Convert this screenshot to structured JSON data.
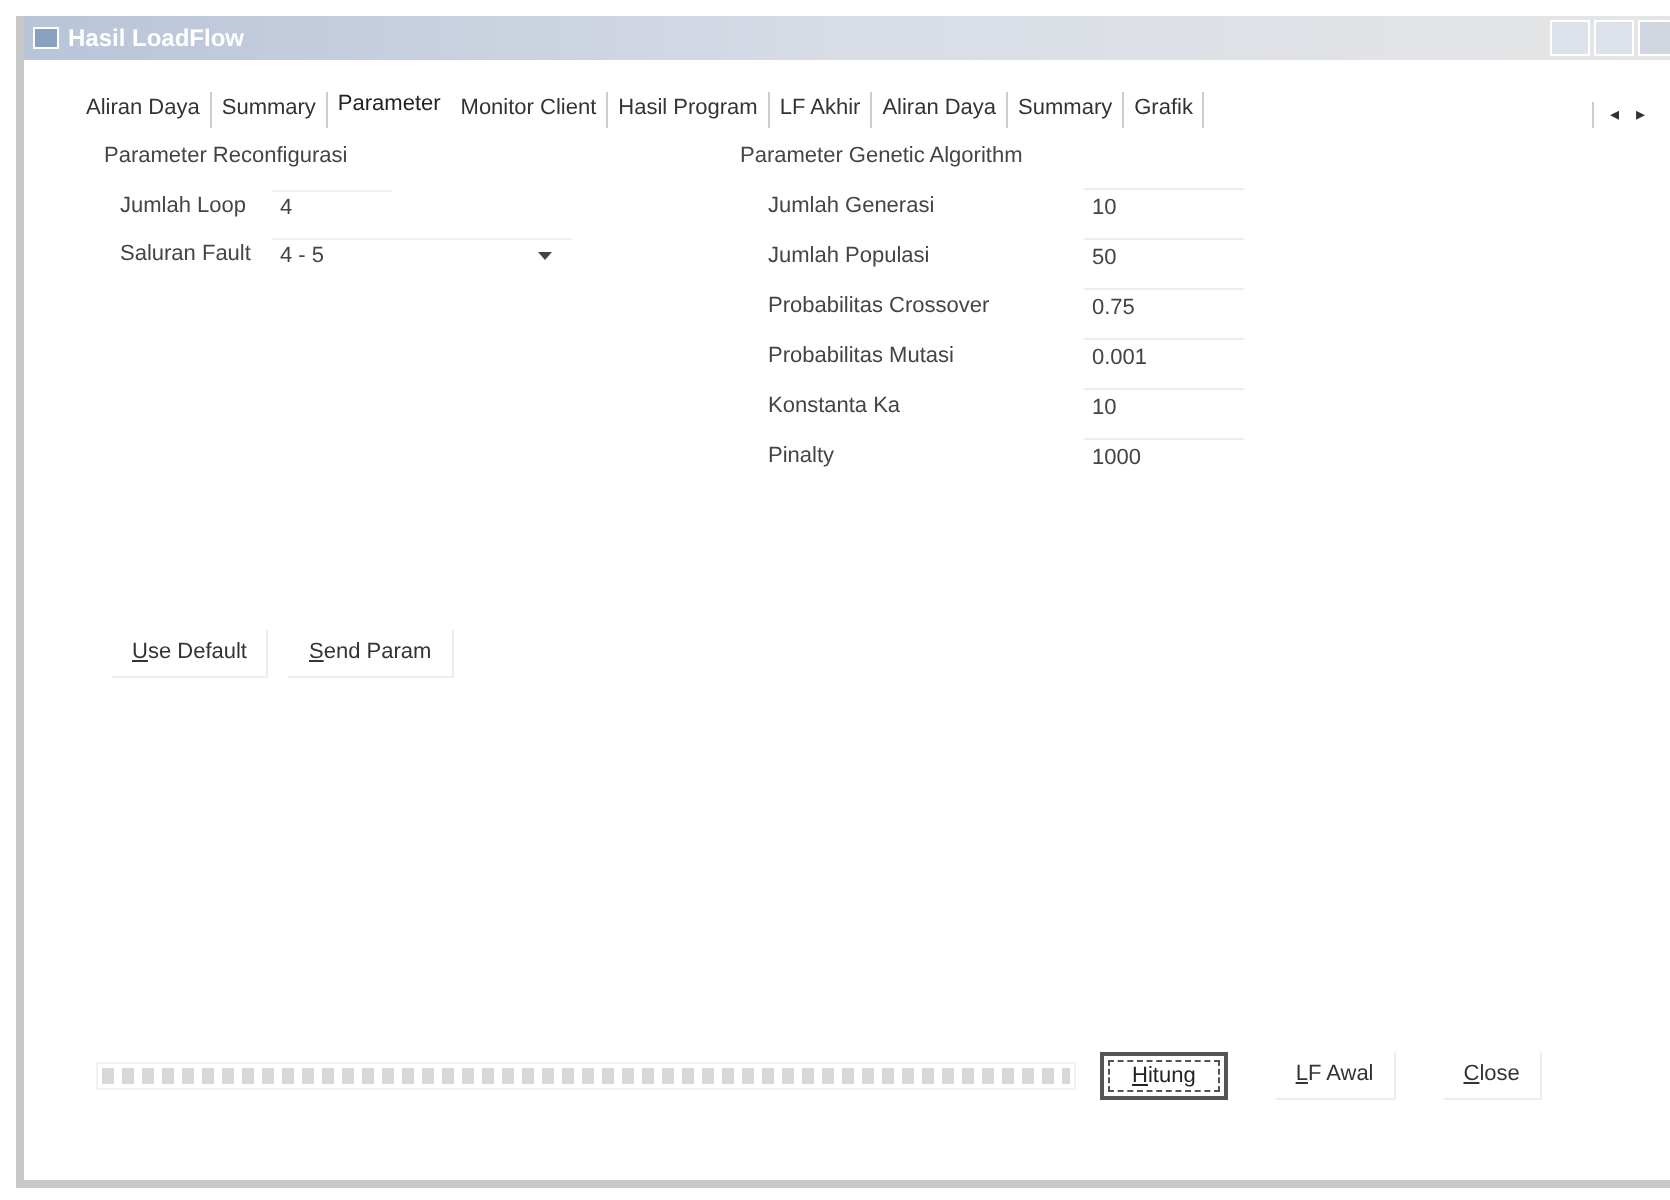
{
  "window": {
    "title": "Hasil LoadFlow"
  },
  "tabs": [
    {
      "label": "Aliran Daya",
      "selected": false
    },
    {
      "label": "Summary",
      "selected": false
    },
    {
      "label": "Parameter",
      "selected": true
    },
    {
      "label": "Monitor Client",
      "selected": false
    },
    {
      "label": "Hasil Program",
      "selected": false
    },
    {
      "label": "LF Akhir",
      "selected": false
    },
    {
      "label": "Aliran Daya",
      "selected": false
    },
    {
      "label": "Summary",
      "selected": false
    },
    {
      "label": "Grafik",
      "selected": false
    }
  ],
  "tab_scroll": [
    "◂",
    "▸"
  ],
  "reconfig": {
    "title": "Parameter Reconfigurasi",
    "fields": [
      {
        "kind": "text",
        "label": "Jumlah Loop",
        "value": "4"
      },
      {
        "kind": "dropdown",
        "label": "Saluran Fault",
        "value": "4 - 5"
      }
    ]
  },
  "genetic": {
    "title": "Parameter Genetic Algorithm",
    "fields": [
      {
        "label": "Jumlah Generasi",
        "value": "10"
      },
      {
        "label": "Jumlah Populasi",
        "value": "50"
      },
      {
        "label": "Probabilitas Crossover",
        "value": "0.75"
      },
      {
        "label": "Probabilitas Mutasi",
        "value": "0.001"
      },
      {
        "label": "Konstanta Ka",
        "value": "10"
      },
      {
        "label": "Pinalty",
        "value": "1000"
      }
    ]
  },
  "param_buttons": [
    {
      "label": "Use Default",
      "underline_first": true,
      "focused": false
    },
    {
      "label": "Send Param",
      "underline_first": true,
      "focused": false
    }
  ],
  "progress": {
    "level": 1
  },
  "buttons": [
    {
      "label": "Hitung",
      "underline_first": true,
      "focused": true
    },
    {
      "label": "LF Awal",
      "underline_first": true,
      "focused": false
    },
    {
      "label": "Close",
      "underline_first": true,
      "focused": false
    }
  ]
}
